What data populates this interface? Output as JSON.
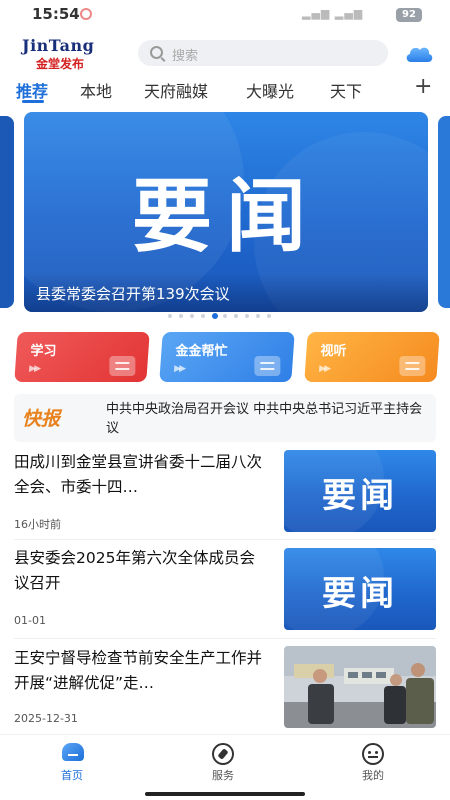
{
  "status": {
    "time": "15:54",
    "battery": "92"
  },
  "app": {
    "logo_en": "JinTang",
    "logo_cn": "金堂发布"
  },
  "search": {
    "placeholder": "搜索"
  },
  "tabs": [
    {
      "label": "推荐",
      "active": true
    },
    {
      "label": "本地"
    },
    {
      "label": "天府融媒"
    },
    {
      "label": "大曝光"
    },
    {
      "label": "天下"
    }
  ],
  "carousel": {
    "big_text": "要闻",
    "caption": "县委常委会召开第139次会议",
    "dot_count": 10,
    "active_dot": 4
  },
  "quick": [
    {
      "label": "学习",
      "color": "#e83a3a"
    },
    {
      "label": "金金帮忙",
      "color": "#3a86ea"
    },
    {
      "label": "视听",
      "color": "#f7931e"
    }
  ],
  "flash": {
    "label": "快报",
    "text": "中共中央政治局召开会议 中共中央总书记习近平主持会议"
  },
  "news": [
    {
      "title": "田成川到金堂县宣讲省委十二届八次全会、市委十四…",
      "time": "16小时前",
      "thumb_text": "要闻"
    },
    {
      "title": "县安委会2025年第六次全体成员会议召开",
      "time": "01-01",
      "thumb_text": "要闻"
    },
    {
      "title": "王安宁督导检查节前安全生产工作并开展“进解优促”走…",
      "time": "2025-12-31"
    }
  ],
  "bottom_nav": [
    {
      "label": "首页",
      "active": true
    },
    {
      "label": "服务"
    },
    {
      "label": "我的"
    }
  ],
  "colors": {
    "accent": "#1e6fd9",
    "flash": "#e8821e"
  }
}
